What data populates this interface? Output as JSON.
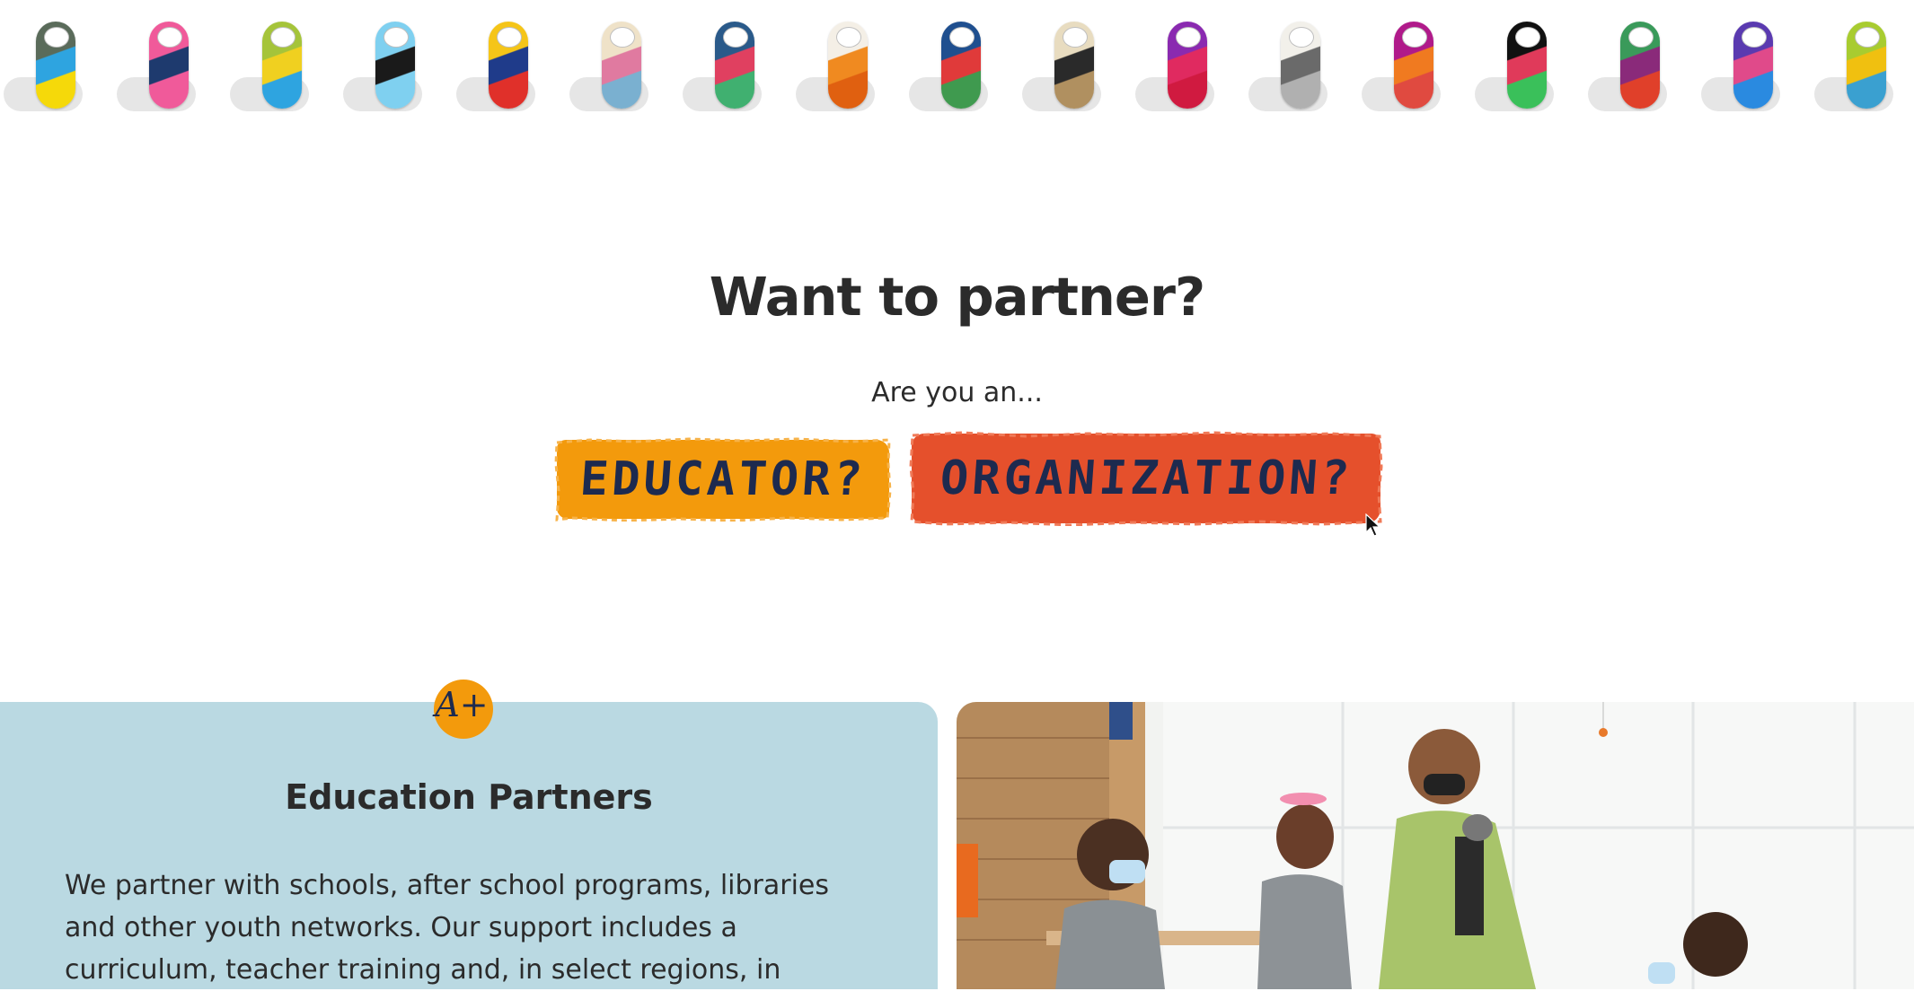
{
  "tags": [
    {
      "name": "tag-art-1",
      "colors": [
        "#5a6b5a",
        "#2ea4e0",
        "#f5d90a"
      ]
    },
    {
      "name": "tag-art-2",
      "colors": [
        "#f05a9a",
        "#1e3a6e",
        "#f05a9a"
      ]
    },
    {
      "name": "tag-art-3",
      "colors": [
        "#a5c43a",
        "#f0d020",
        "#2ea4e0"
      ]
    },
    {
      "name": "tag-art-4",
      "colors": [
        "#7fd0f0",
        "#1a1a1a",
        "#7fd0f0"
      ]
    },
    {
      "name": "tag-art-5",
      "colors": [
        "#f5c518",
        "#1f3b8a",
        "#e0302a"
      ]
    },
    {
      "name": "tag-art-6",
      "colors": [
        "#efe2c8",
        "#e07aa0",
        "#7ab0d0"
      ]
    },
    {
      "name": "tag-art-7",
      "colors": [
        "#2a5a8a",
        "#e04060",
        "#40b070"
      ]
    },
    {
      "name": "tag-art-8",
      "colors": [
        "#f4efe6",
        "#f08a20",
        "#e06010"
      ]
    },
    {
      "name": "tag-art-9",
      "colors": [
        "#1f4f8f",
        "#e03a3a",
        "#3f9a4f"
      ]
    },
    {
      "name": "tag-art-10",
      "colors": [
        "#e8dcc0",
        "#2a2a2a",
        "#b09060"
      ]
    },
    {
      "name": "tag-art-11",
      "colors": [
        "#8a2ab0",
        "#e02a60",
        "#d01a40"
      ]
    },
    {
      "name": "tag-art-12",
      "colors": [
        "#f2f0ea",
        "#6a6a6a",
        "#b0b0b0"
      ]
    },
    {
      "name": "tag-art-13",
      "colors": [
        "#b01a8a",
        "#f07a20",
        "#e04a40"
      ]
    },
    {
      "name": "tag-art-14",
      "colors": [
        "#111111",
        "#e03a5a",
        "#3ac05a"
      ]
    },
    {
      "name": "tag-art-15",
      "colors": [
        "#3a9a5a",
        "#8a2a7a",
        "#e0402a"
      ]
    },
    {
      "name": "tag-art-16",
      "colors": [
        "#5a3ab0",
        "#e04a8a",
        "#2a8ae0"
      ]
    },
    {
      "name": "tag-art-17",
      "colors": [
        "#a8cc30",
        "#f0c010",
        "#3aa0d0"
      ]
    }
  ],
  "partner": {
    "title": "Want to partner?",
    "subtitle": "Are you an...",
    "educator_label": "EDUCATOR?",
    "organization_label": "ORGANIZATION?"
  },
  "colors": {
    "educator_button": "#f39a0c",
    "organization_button": "#e5502c",
    "button_text": "#1d2a4f",
    "card_background": "#bad9e2",
    "aplus_badge": "#f39a0c"
  },
  "education_card": {
    "icon": "a-plus-icon",
    "icon_text": "A+",
    "title": "Education Partners",
    "body": "We partner with schools, after school programs, libraries and other youth networks. Our support includes a curriculum, teacher training and, in select regions, in"
  }
}
